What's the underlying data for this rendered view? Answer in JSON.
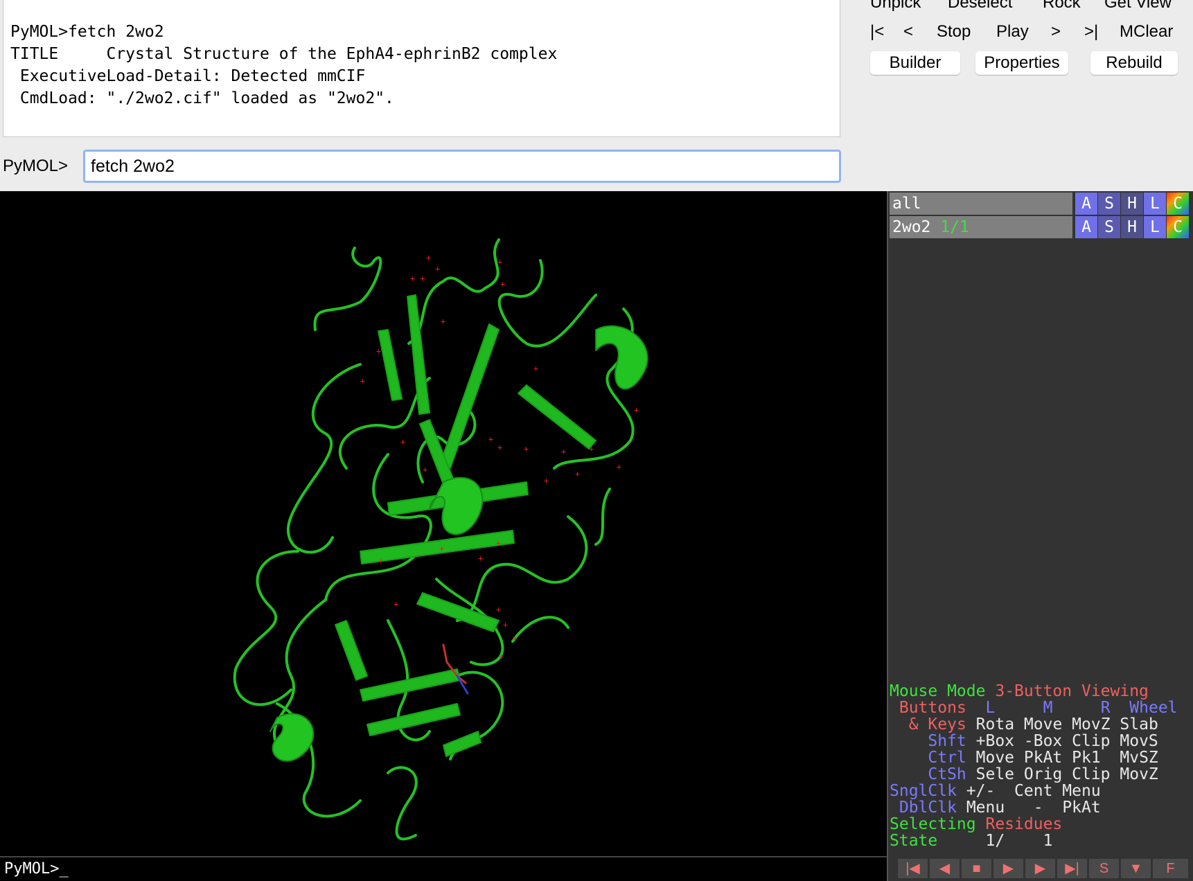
{
  "log": {
    "lines": [
      "PyMOL>fetch 2wo2",
      "TITLE     Crystal Structure of the EphA4-ephrinB2 complex",
      " ExecutiveLoad-Detail: Detected mmCIF",
      " CmdLoad: \"./2wo2.cif\" loaded as \"2wo2\"."
    ]
  },
  "command": {
    "label": "PyMOL>",
    "value": "fetch 2wo2"
  },
  "top_buttons": [
    "Unpick",
    "Deselect",
    "Rock",
    "Get View"
  ],
  "movie_buttons": [
    "|<",
    "<",
    "Stop",
    "Play",
    ">",
    ">|",
    "MClear"
  ],
  "panel_buttons": [
    "Builder",
    "Properties",
    "Rebuild"
  ],
  "objects": [
    {
      "name": "all",
      "state": ""
    },
    {
      "name": "2wo2",
      "state": "1/1"
    }
  ],
  "object_buttons": [
    "A",
    "S",
    "H",
    "L",
    "C"
  ],
  "mouse_mode": {
    "title": "Mouse Mode",
    "mode": "3-Button Viewing",
    "buttons_label": "Buttons",
    "button_cols": [
      "L",
      "M",
      "R",
      "Wheel"
    ],
    "rows": [
      {
        "key": "& Keys",
        "cols": [
          "Rota",
          "Move",
          "MovZ",
          "Slab"
        ]
      },
      {
        "key": "Shft",
        "cols": [
          "+Box",
          "-Box",
          "Clip",
          "MovS"
        ]
      },
      {
        "key": "Ctrl",
        "cols": [
          "Move",
          "PkAt",
          "Pk1",
          "MvSZ"
        ]
      },
      {
        "key": "CtSh",
        "cols": [
          "Sele",
          "Orig",
          "Clip",
          "MovZ"
        ]
      },
      {
        "key": "SnglClk",
        "cols": [
          "+/-",
          "Cent",
          "Menu",
          ""
        ]
      },
      {
        "key": "DblClk",
        "cols": [
          "Menu",
          "-",
          "PkAt",
          ""
        ]
      }
    ],
    "selecting_label": "Selecting",
    "selecting_value": "Residues",
    "state_label": "State",
    "state_value": "1/    1"
  },
  "bottom_prompt": "PyMOL>_",
  "playback": [
    "|◀",
    "◀",
    "■",
    "▶",
    "▶",
    "▶|",
    "S",
    "▼",
    "F"
  ],
  "colors": {
    "ribbon": "#22c422",
    "water": "#e02020",
    "background": "#000000"
  }
}
